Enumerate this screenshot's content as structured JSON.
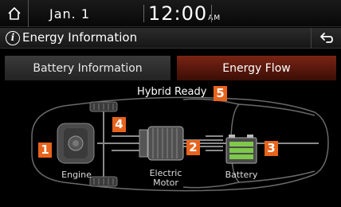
{
  "status_bar": {
    "date": "Jan.  1",
    "time": "12:00",
    "ampm": "AM"
  },
  "title_bar": {
    "title": "Energy Information"
  },
  "tabs": [
    {
      "label": "Battery Information",
      "active": false
    },
    {
      "label": "Energy Flow",
      "active": true
    }
  ],
  "energy_flow": {
    "status": "Hybrid Ready",
    "components": {
      "engine": {
        "label": "Engine",
        "badge": "1"
      },
      "motor": {
        "label_line1": "Electric",
        "label_line2": "Motor",
        "badge": "2"
      },
      "battery": {
        "label": "Battery",
        "badge": "3"
      },
      "wheels_badge": "4",
      "status_badge": "5"
    }
  },
  "colors": {
    "accent": "#e8631c",
    "active_tab": "#6a1e10",
    "battery_green": "#7ec84a"
  }
}
